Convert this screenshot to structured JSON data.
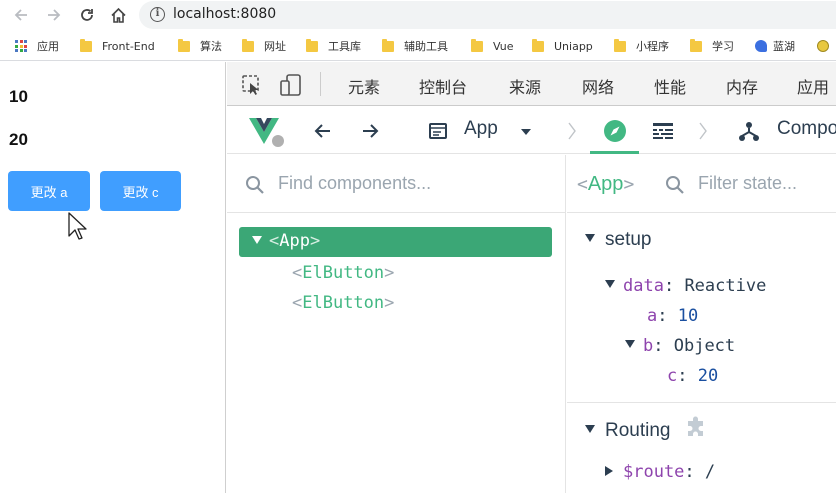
{
  "browser": {
    "url": "localhost:8080",
    "bookmarks": [
      {
        "label": "应用",
        "icon": "apps-grid-icon"
      },
      {
        "label": "Front-End",
        "icon": "folder-icon"
      },
      {
        "label": "算法",
        "icon": "folder-icon"
      },
      {
        "label": "网址",
        "icon": "folder-icon"
      },
      {
        "label": "工具库",
        "icon": "folder-icon"
      },
      {
        "label": "辅助工具",
        "icon": "folder-icon"
      },
      {
        "label": "Vue",
        "icon": "folder-icon"
      },
      {
        "label": "Uniapp",
        "icon": "folder-icon"
      },
      {
        "label": "小程序",
        "icon": "folder-icon"
      },
      {
        "label": "学习",
        "icon": "folder-icon"
      },
      {
        "label": "蓝湖",
        "icon": "lanhu-icon"
      }
    ]
  },
  "app": {
    "value_a": "10",
    "value_c": "20",
    "button_a": "更改 a",
    "button_c": "更改 c",
    "button_color": "#409eff"
  },
  "devtools": {
    "tabs": [
      "元素",
      "控制台",
      "来源",
      "网络",
      "性能",
      "内存",
      "应用"
    ],
    "vue": {
      "app_selector": "App",
      "components_label": "Compo",
      "accent_color": "#42b883",
      "search_placeholder": "Find components...",
      "filter_placeholder": "Filter state...",
      "selected_component": "App",
      "tree": [
        {
          "name": "App",
          "selected": true
        },
        {
          "name": "ElButton",
          "selected": false
        },
        {
          "name": "ElButton",
          "selected": false
        }
      ],
      "state": {
        "setup_title": "setup",
        "data_key": "data",
        "data_type": "Reactive",
        "a_key": "a",
        "a_value": "10",
        "b_key": "b",
        "b_type": "Object",
        "c_key": "c",
        "c_value": "20",
        "routing_title": "Routing",
        "route_key": "$route",
        "route_value": "/"
      }
    }
  }
}
